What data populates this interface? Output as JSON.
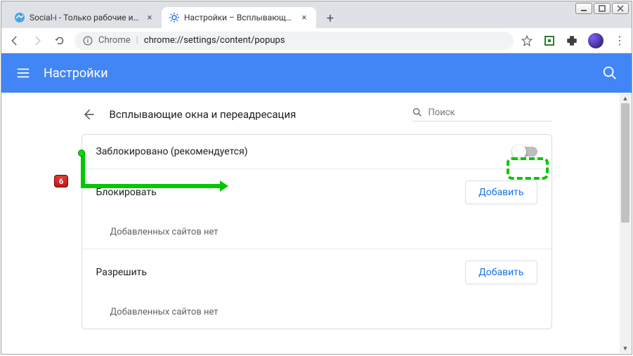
{
  "window": {
    "controls": [
      "min",
      "max",
      "close"
    ]
  },
  "tabs": [
    {
      "title": "Social-i - Только рабочие инстр",
      "active": false
    },
    {
      "title": "Настройки – Всплывающие окн",
      "active": true
    }
  ],
  "toolbar": {
    "security_label": "Chrome",
    "url": "chrome://settings/content/popups"
  },
  "settings_header": {
    "title": "Настройки"
  },
  "page": {
    "title": "Всплывающие окна и переадресация",
    "search_placeholder": "Поиск",
    "blocked_row": "Заблокировано (рекомендуется)",
    "block_section": "Блокировать",
    "allow_section": "Разрешить",
    "empty_text": "Добавленных сайтов нет",
    "add_button": "Добавить"
  },
  "annotation": {
    "badge": "6"
  }
}
